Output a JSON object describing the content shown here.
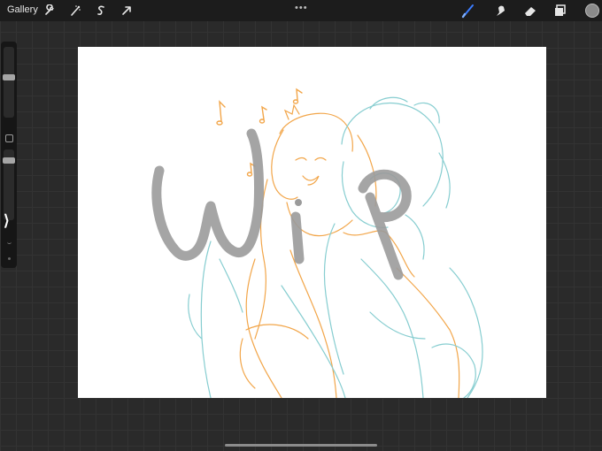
{
  "topbar": {
    "gallery_label": "Gallery",
    "more_label": "•••",
    "tools_left": [
      {
        "name": "wrench-icon"
      },
      {
        "name": "adjustments-icon"
      },
      {
        "name": "selection-icon"
      },
      {
        "name": "transform-icon"
      }
    ],
    "tools_right": [
      {
        "name": "brush-icon",
        "active": true
      },
      {
        "name": "smudge-icon"
      },
      {
        "name": "eraser-icon"
      },
      {
        "name": "layers-icon"
      }
    ],
    "current_color": "#8a8a8a",
    "active_tool_color": "#3b7cff"
  },
  "sidebar": {
    "brush_size_level": 0.55,
    "opacity_level": 0.32,
    "collapse_arrow": "⟩"
  },
  "canvas": {
    "watermark_text": "WIP",
    "line_colors": {
      "orange": "#f2a64a",
      "teal": "#86cdd0",
      "watermark": "#9b9b9b"
    }
  }
}
